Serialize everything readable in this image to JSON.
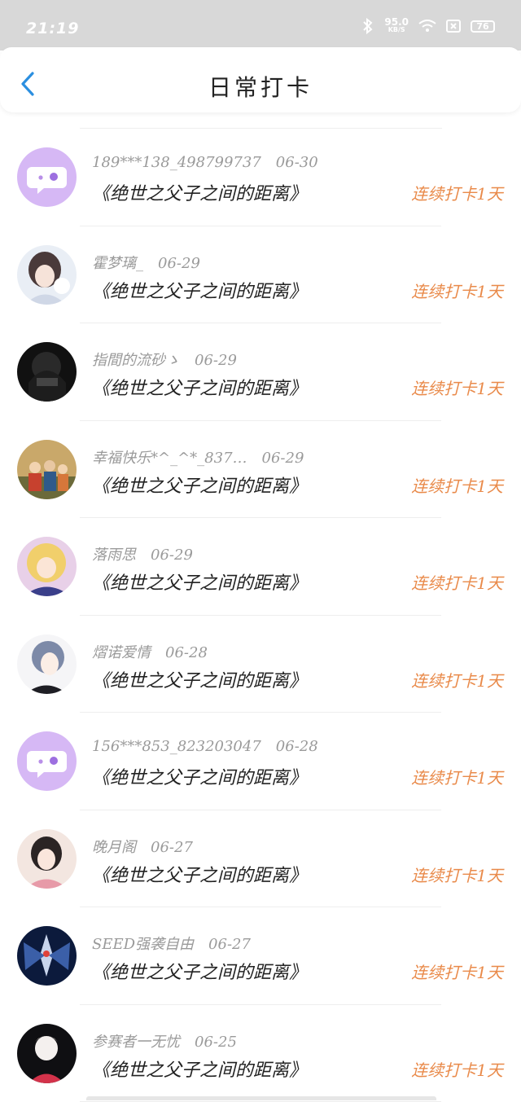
{
  "status": {
    "time": "21:19",
    "speed": "95.0",
    "speed_unit": "KB/S",
    "battery": "76"
  },
  "header": {
    "title": "日常打卡"
  },
  "rows": [
    {
      "user": "189***138_498799737",
      "date": "06-30",
      "book": "《绝世之父子之间的距离》",
      "streak": "连续打卡1天",
      "avatar": "default"
    },
    {
      "user": "霍梦璃_",
      "date": "06-29",
      "book": "《绝世之父子之间的距离》",
      "streak": "连续打卡1天",
      "avatar": "anime-girl-cat"
    },
    {
      "user": "指間的流砂ゝ",
      "date": "06-29",
      "book": "《绝世之父子之间的距离》",
      "streak": "连续打卡1天",
      "avatar": "dark"
    },
    {
      "user": "幸福快乐*^_^*_837…",
      "date": "06-29",
      "book": "《绝世之父子之间的距离》",
      "streak": "连续打卡1天",
      "avatar": "family-photo"
    },
    {
      "user": "落雨思",
      "date": "06-29",
      "book": "《绝世之父子之间的距离》",
      "streak": "连续打卡1天",
      "avatar": "anime-blonde"
    },
    {
      "user": "熠诺爱情",
      "date": "06-28",
      "book": "《绝世之父子之间的距离》",
      "streak": "连续打卡1天",
      "avatar": "anime-boy"
    },
    {
      "user": "156***853_823203047",
      "date": "06-28",
      "book": "《绝世之父子之间的距离》",
      "streak": "连续打卡1天",
      "avatar": "default"
    },
    {
      "user": "晚月阁",
      "date": "06-27",
      "book": "《绝世之父子之间的距离》",
      "streak": "连续打卡1天",
      "avatar": "anime-pink"
    },
    {
      "user": "SEED强袭自由",
      "date": "06-27",
      "book": "《绝世之父子之间的距离》",
      "streak": "连续打卡1天",
      "avatar": "mecha"
    },
    {
      "user": "参赛者一无忧",
      "date": "06-25",
      "book": "《绝世之父子之间的距离》",
      "streak": "连续打卡1天",
      "avatar": "anime-dark"
    }
  ],
  "colors": {
    "accent": "#e98a4a",
    "back": "#2b8fe0",
    "default_avatar": "#d6b8f5"
  }
}
